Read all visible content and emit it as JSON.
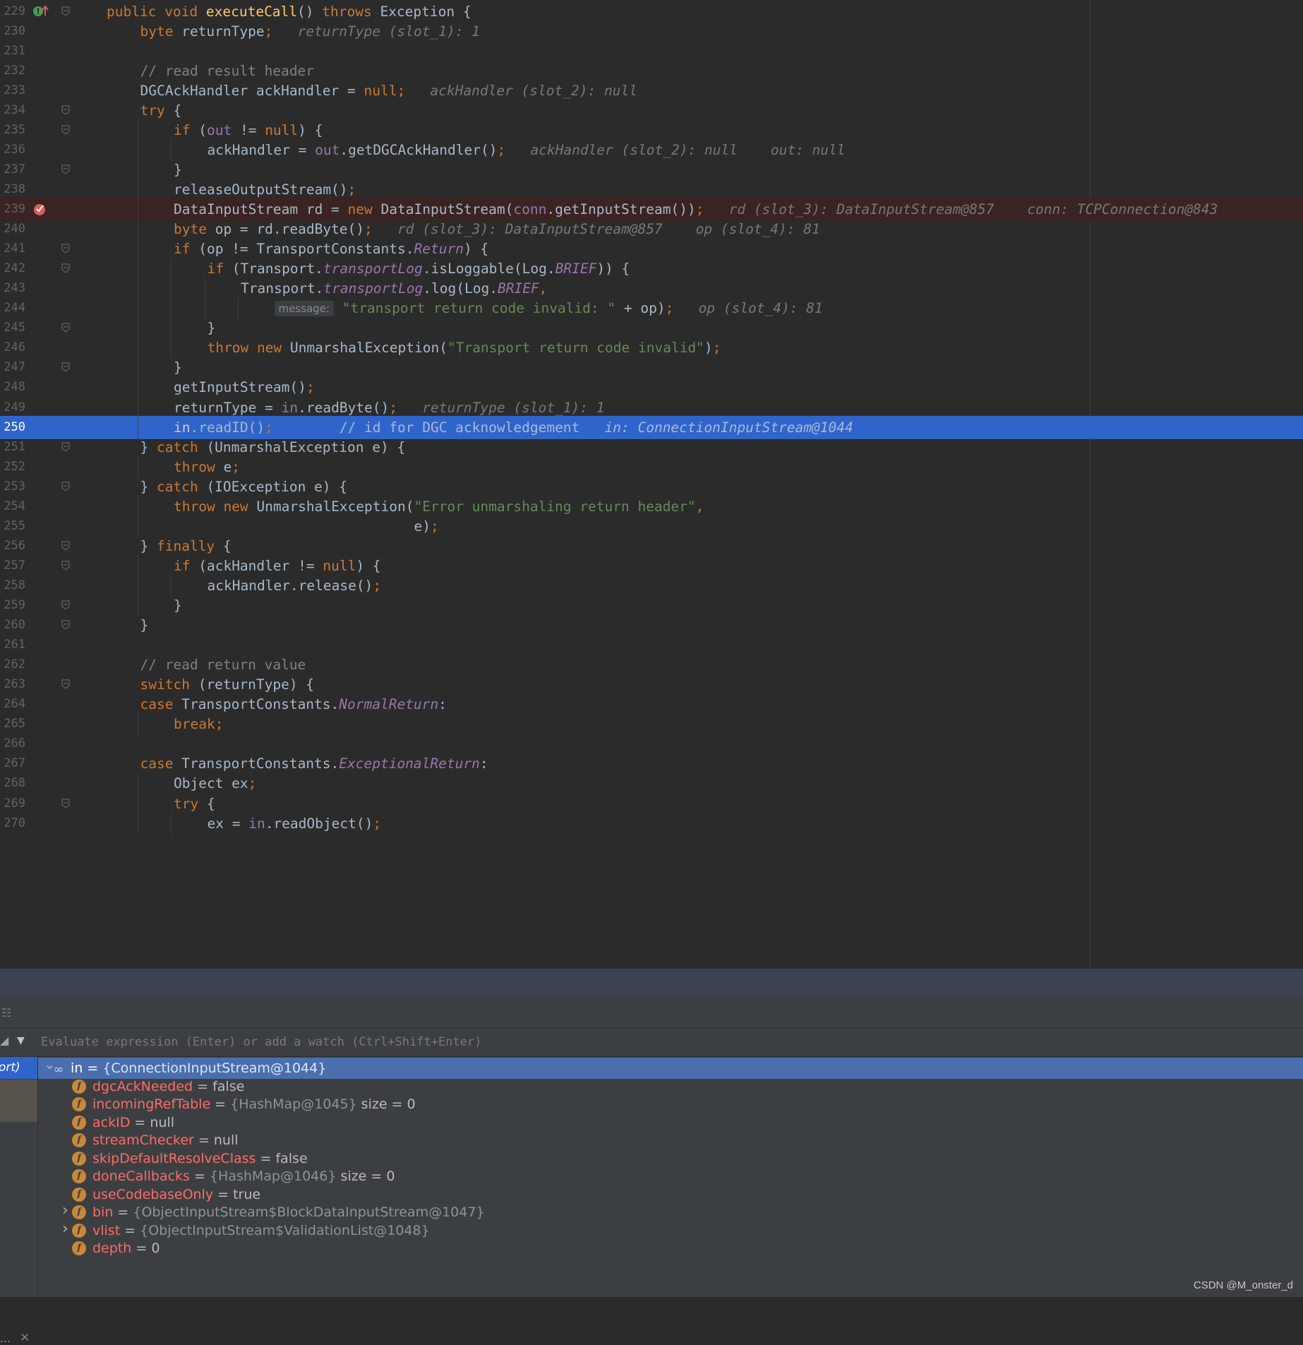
{
  "editor": {
    "lines": [
      {
        "num": "229",
        "indent": 0,
        "mark": "override",
        "fold": true,
        "tokens": [
          [
            "kw",
            "public "
          ],
          [
            "kw",
            "void "
          ],
          [
            "fn",
            "executeCall"
          ],
          [
            "",
            "() "
          ],
          [
            "kw",
            "throws "
          ],
          [
            "",
            "Exception {"
          ]
        ]
      },
      {
        "num": "230",
        "indent": 1,
        "tokens": [
          [
            "kw",
            "byte "
          ],
          [
            "",
            "returnType"
          ],
          [
            "kw",
            ";"
          ],
          [
            "hint",
            "   returnType (slot_1): 1"
          ]
        ]
      },
      {
        "num": "231",
        "indent": 1,
        "tokens": []
      },
      {
        "num": "232",
        "indent": 1,
        "tokens": [
          [
            "cm",
            "// read result header"
          ]
        ]
      },
      {
        "num": "233",
        "indent": 1,
        "tokens": [
          [
            "",
            "DGCAckHandler ackHandler = "
          ],
          [
            "kw",
            "null;"
          ],
          [
            "hint",
            "   ackHandler (slot_2): null"
          ]
        ]
      },
      {
        "num": "234",
        "indent": 1,
        "fold": true,
        "tokens": [
          [
            "kw",
            "try "
          ],
          [
            "",
            "{"
          ]
        ]
      },
      {
        "num": "235",
        "indent": 2,
        "fold": true,
        "tokens": [
          [
            "kw",
            "if "
          ],
          [
            "",
            "("
          ],
          [
            "fld",
            "out"
          ],
          [
            "",
            " != "
          ],
          [
            "kw",
            "null"
          ],
          [
            "",
            ") {"
          ]
        ]
      },
      {
        "num": "236",
        "indent": 3,
        "tokens": [
          [
            "",
            "ackHandler = "
          ],
          [
            "fld",
            "out"
          ],
          [
            "",
            ".getDGCAckHandler()"
          ],
          [
            "kw",
            ";"
          ],
          [
            "hint",
            "   ackHandler (slot_2): null    out: null"
          ]
        ]
      },
      {
        "num": "237",
        "indent": 2,
        "fold": true,
        "tokens": [
          [
            "",
            "}"
          ]
        ]
      },
      {
        "num": "238",
        "indent": 2,
        "tokens": [
          [
            "",
            "releaseOutputStream()"
          ],
          [
            "kw",
            ";"
          ]
        ]
      },
      {
        "num": "239",
        "indent": 2,
        "mark": "breakpoint",
        "bg": "bp",
        "tokens": [
          [
            "",
            "DataInputStream rd = "
          ],
          [
            "kw",
            "new "
          ],
          [
            "",
            "DataInputStream("
          ],
          [
            "fld",
            "conn"
          ],
          [
            "",
            ".getInputStream())"
          ],
          [
            "kw",
            ";"
          ],
          [
            "hint",
            "   rd (slot_3): DataInputStream@857    conn: TCPConnection@843"
          ]
        ]
      },
      {
        "num": "240",
        "indent": 2,
        "tokens": [
          [
            "kw",
            "byte "
          ],
          [
            "",
            "op = rd.readByte()"
          ],
          [
            "kw",
            ";"
          ],
          [
            "hint",
            "   rd (slot_3): DataInputStream@857    op (slot_4): 81"
          ]
        ]
      },
      {
        "num": "241",
        "indent": 2,
        "fold": true,
        "tokens": [
          [
            "kw",
            "if "
          ],
          [
            "",
            "(op != TransportConstants."
          ],
          [
            "sfld",
            "Return"
          ],
          [
            "",
            ") {"
          ]
        ]
      },
      {
        "num": "242",
        "indent": 3,
        "fold": true,
        "tokens": [
          [
            "kw",
            "if "
          ],
          [
            "",
            "(Transport."
          ],
          [
            "sfld",
            "transportLog"
          ],
          [
            "",
            ".isLoggable(Log."
          ],
          [
            "sfld",
            "BRIEF"
          ],
          [
            "",
            ")) {"
          ]
        ]
      },
      {
        "num": "243",
        "indent": 4,
        "tokens": [
          [
            "",
            "Transport."
          ],
          [
            "sfld",
            "transportLog"
          ],
          [
            "",
            ".log(Log."
          ],
          [
            "sfld",
            "BRIEF"
          ],
          [
            "kw",
            ","
          ]
        ]
      },
      {
        "num": "244",
        "indent": 5,
        "tokens": [
          [
            "param",
            "message:"
          ],
          [
            "",
            " "
          ],
          [
            "st",
            "\"transport return code invalid: \""
          ],
          [
            "",
            " + op)"
          ],
          [
            "kw",
            ";"
          ],
          [
            "hint",
            "   op (slot_4): 81"
          ]
        ]
      },
      {
        "num": "245",
        "indent": 3,
        "fold": true,
        "tokens": [
          [
            "",
            "}"
          ]
        ]
      },
      {
        "num": "246",
        "indent": 3,
        "tokens": [
          [
            "kw",
            "throw new "
          ],
          [
            "",
            "UnmarshalException("
          ],
          [
            "st",
            "\"Transport return code invalid\""
          ],
          [
            "",
            ")"
          ],
          [
            "kw",
            ";"
          ]
        ]
      },
      {
        "num": "247",
        "indent": 2,
        "fold": true,
        "tokens": [
          [
            "",
            "}"
          ]
        ]
      },
      {
        "num": "248",
        "indent": 2,
        "tokens": [
          [
            "",
            "getInputStream()"
          ],
          [
            "kw",
            ";"
          ]
        ]
      },
      {
        "num": "249",
        "indent": 2,
        "tokens": [
          [
            "",
            "returnType = "
          ],
          [
            "fld",
            "in"
          ],
          [
            "",
            ".readByte()"
          ],
          [
            "kw",
            ";"
          ],
          [
            "hint",
            "   returnType (slot_1): 1"
          ]
        ]
      },
      {
        "num": "250",
        "indent": 2,
        "bg": "exec",
        "tokens": [
          [
            "fld",
            "in"
          ],
          [
            "",
            ".readID()"
          ],
          [
            "kw",
            ";"
          ],
          [
            "cm",
            "        // id for DGC acknowledgement"
          ],
          [
            "hint",
            "   in: ConnectionInputStream@1044"
          ]
        ]
      },
      {
        "num": "251",
        "indent": 1,
        "fold": true,
        "tokens": [
          [
            "",
            "} "
          ],
          [
            "kw",
            "catch "
          ],
          [
            "",
            "(UnmarshalException e) {"
          ]
        ]
      },
      {
        "num": "252",
        "indent": 2,
        "tokens": [
          [
            "kw",
            "throw "
          ],
          [
            "",
            "e"
          ],
          [
            "kw",
            ";"
          ]
        ]
      },
      {
        "num": "253",
        "indent": 1,
        "fold": true,
        "tokens": [
          [
            "",
            "} "
          ],
          [
            "kw",
            "catch "
          ],
          [
            "",
            "(IOException e) {"
          ]
        ]
      },
      {
        "num": "254",
        "indent": 2,
        "tokens": [
          [
            "kw",
            "throw new "
          ],
          [
            "",
            "UnmarshalException("
          ],
          [
            "st",
            "\"Error unmarshaling return header\""
          ],
          [
            "kw",
            ","
          ]
        ]
      },
      {
        "num": "255",
        "indent": 2,
        "tokens": [
          [
            "",
            "                             e)"
          ],
          [
            "kw",
            ";"
          ]
        ]
      },
      {
        "num": "256",
        "indent": 1,
        "fold": true,
        "tokens": [
          [
            "",
            "} "
          ],
          [
            "kw",
            "finally "
          ],
          [
            "",
            "{"
          ]
        ]
      },
      {
        "num": "257",
        "indent": 2,
        "fold": true,
        "tokens": [
          [
            "kw",
            "if "
          ],
          [
            "",
            "(ackHandler != "
          ],
          [
            "kw",
            "null"
          ],
          [
            "",
            ") {"
          ]
        ]
      },
      {
        "num": "258",
        "indent": 3,
        "tokens": [
          [
            "",
            "ackHandler.release()"
          ],
          [
            "kw",
            ";"
          ]
        ]
      },
      {
        "num": "259",
        "indent": 2,
        "fold": true,
        "tokens": [
          [
            "",
            "}"
          ]
        ]
      },
      {
        "num": "260",
        "indent": 1,
        "fold": true,
        "tokens": [
          [
            "",
            "}"
          ]
        ]
      },
      {
        "num": "261",
        "indent": 1,
        "tokens": []
      },
      {
        "num": "262",
        "indent": 1,
        "tokens": [
          [
            "cm",
            "// read return value"
          ]
        ]
      },
      {
        "num": "263",
        "indent": 1,
        "fold": true,
        "tokens": [
          [
            "kw",
            "switch "
          ],
          [
            "",
            "(returnType) {"
          ]
        ]
      },
      {
        "num": "264",
        "indent": 1,
        "tokens": [
          [
            "kw",
            "case "
          ],
          [
            "",
            "TransportConstants."
          ],
          [
            "sfld",
            "NormalReturn"
          ],
          [
            "",
            ":"
          ]
        ]
      },
      {
        "num": "265",
        "indent": 2,
        "tokens": [
          [
            "kw",
            "break;"
          ]
        ]
      },
      {
        "num": "266",
        "indent": 1,
        "tokens": []
      },
      {
        "num": "267",
        "indent": 1,
        "tokens": [
          [
            "kw",
            "case "
          ],
          [
            "",
            "TransportConstants."
          ],
          [
            "sfld",
            "ExceptionalReturn"
          ],
          [
            "",
            ":"
          ]
        ]
      },
      {
        "num": "268",
        "indent": 2,
        "tokens": [
          [
            "",
            "Object ex"
          ],
          [
            "kw",
            ";"
          ]
        ]
      },
      {
        "num": "269",
        "indent": 2,
        "fold": true,
        "tokens": [
          [
            "kw",
            "try "
          ],
          [
            "",
            "{"
          ]
        ]
      },
      {
        "num": "270",
        "indent": 3,
        "tokens": [
          [
            "",
            "ex = "
          ],
          [
            "fld",
            "in"
          ],
          [
            "",
            ".readObject()"
          ],
          [
            "kw",
            ";"
          ]
        ]
      }
    ]
  },
  "debugger": {
    "watch_placeholder": "Evaluate expression (Enter) or add a watch (Ctrl+Shift+Enter)",
    "frame_label": "ort)",
    "frame_bottom": "…",
    "variables": [
      {
        "level": 0,
        "kind": "watch",
        "expander": "open",
        "name": "in",
        "eq": " = ",
        "obj": "{ConnectionInputStream@1044}",
        "extra": ""
      },
      {
        "level": 1,
        "kind": "field",
        "expander": "",
        "name": "dgcAckNeeded",
        "eq": " = ",
        "obj": "",
        "extra": "false"
      },
      {
        "level": 1,
        "kind": "field",
        "expander": "",
        "name": "incomingRefTable",
        "eq": " = ",
        "obj": "{HashMap@1045}",
        "extra": "  size = 0"
      },
      {
        "level": 1,
        "kind": "field",
        "expander": "",
        "name": "ackID",
        "eq": " = ",
        "obj": "",
        "extra": "null"
      },
      {
        "level": 1,
        "kind": "field",
        "expander": "",
        "name": "streamChecker",
        "eq": " = ",
        "obj": "",
        "extra": "null"
      },
      {
        "level": 1,
        "kind": "field",
        "expander": "",
        "name": "skipDefaultResolveClass",
        "eq": " = ",
        "obj": "",
        "extra": "false"
      },
      {
        "level": 1,
        "kind": "field",
        "expander": "",
        "name": "doneCallbacks",
        "eq": " = ",
        "obj": "{HashMap@1046}",
        "extra": "  size = 0"
      },
      {
        "level": 1,
        "kind": "field",
        "expander": "",
        "name": "useCodebaseOnly",
        "eq": " = ",
        "obj": "",
        "extra": "true"
      },
      {
        "level": 1,
        "kind": "field",
        "expander": "closed",
        "name": "bin",
        "eq": " = ",
        "obj": "{ObjectInputStream$BlockDataInputStream@1047}",
        "extra": ""
      },
      {
        "level": 1,
        "kind": "field",
        "expander": "closed",
        "name": "vlist",
        "eq": " = ",
        "obj": "{ObjectInputStream$ValidationList@1048}",
        "extra": ""
      },
      {
        "level": 1,
        "kind": "field",
        "expander": "",
        "name": "depth",
        "eq": " = ",
        "obj": "",
        "extra": "0"
      }
    ]
  },
  "watermark": "CSDN @M_onster_d",
  "colors": {
    "selection": "#2f65ca",
    "keyword": "#cc7832",
    "string": "#6a8759",
    "field": "#9876aa"
  }
}
